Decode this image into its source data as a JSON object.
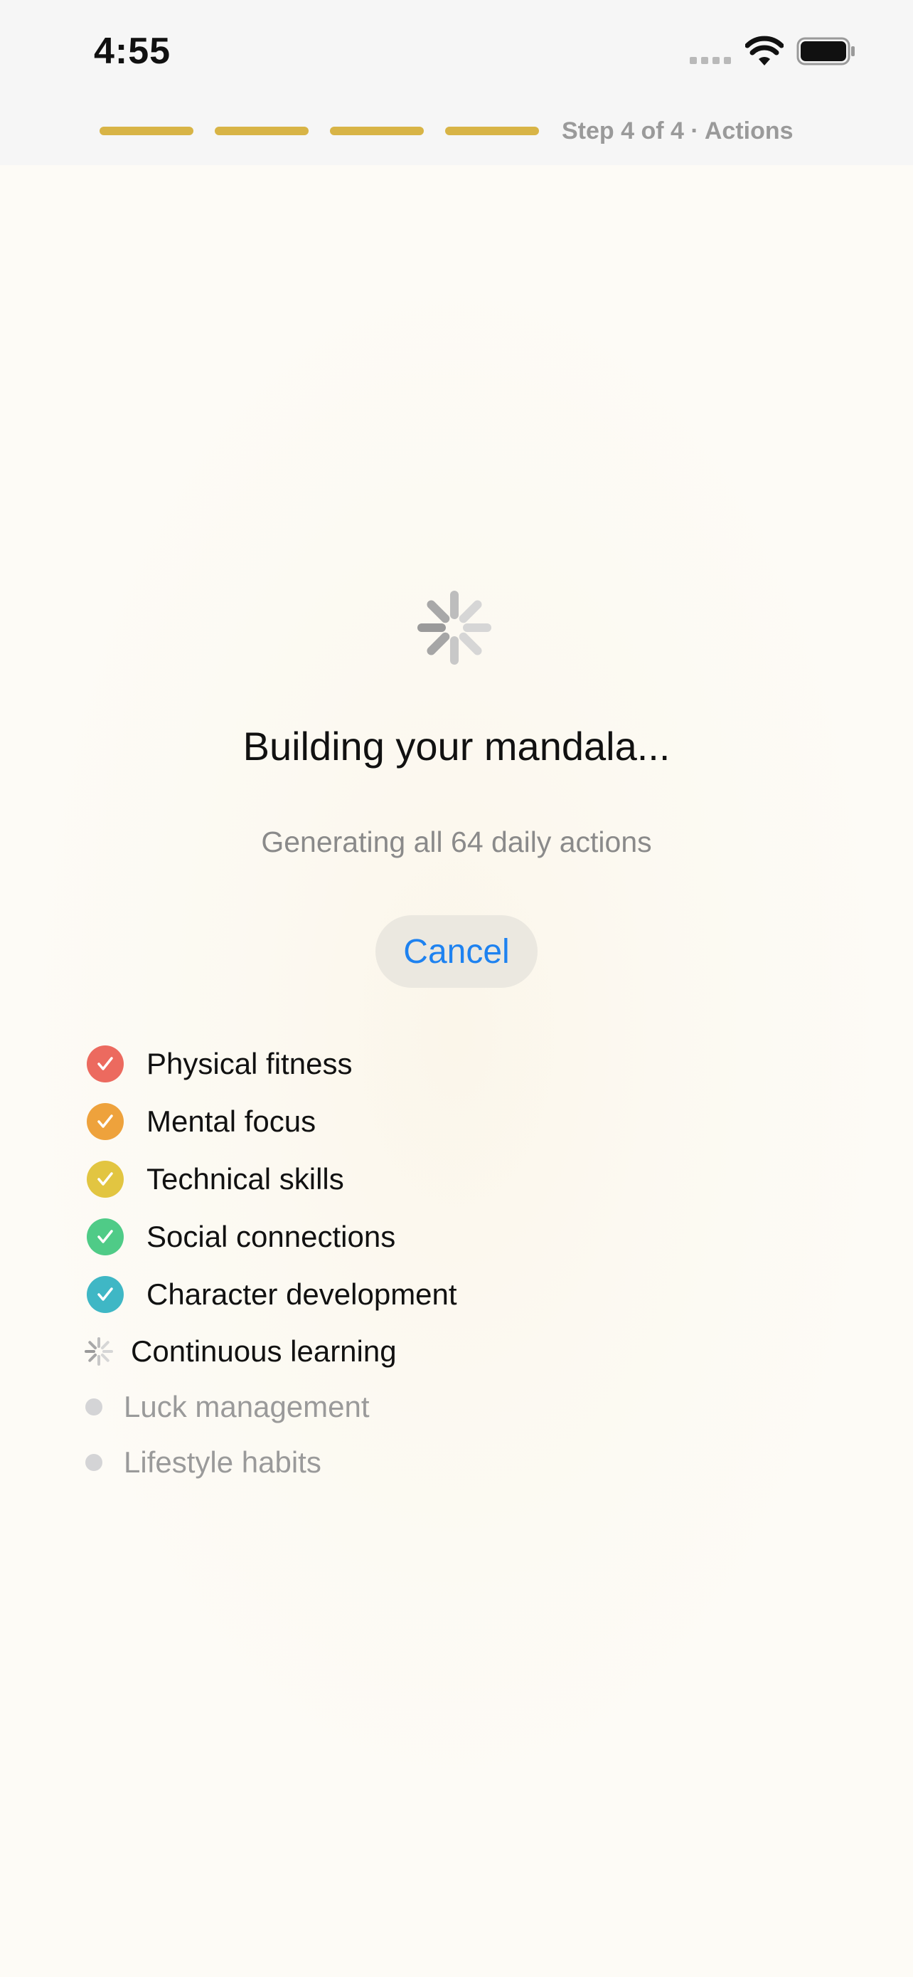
{
  "status_bar": {
    "time": "4:55"
  },
  "progress": {
    "segments": 4,
    "completed": 4,
    "label": "Step 4 of 4 · Actions",
    "color": "#d8b446"
  },
  "main": {
    "title": "Building your mandala...",
    "subtitle": "Generating all 64 daily actions",
    "cancel_label": "Cancel"
  },
  "categories": [
    {
      "label": "Physical fitness",
      "status": "done",
      "color": "#ec6a5f"
    },
    {
      "label": "Mental focus",
      "status": "done",
      "color": "#eea23c"
    },
    {
      "label": "Technical skills",
      "status": "done",
      "color": "#e2c541"
    },
    {
      "label": "Social connections",
      "status": "done",
      "color": "#4fcb87"
    },
    {
      "label": "Character development",
      "status": "done",
      "color": "#3fb7c5"
    },
    {
      "label": "Continuous learning",
      "status": "active"
    },
    {
      "label": "Luck management",
      "status": "pending"
    },
    {
      "label": "Lifestyle habits",
      "status": "pending"
    }
  ]
}
